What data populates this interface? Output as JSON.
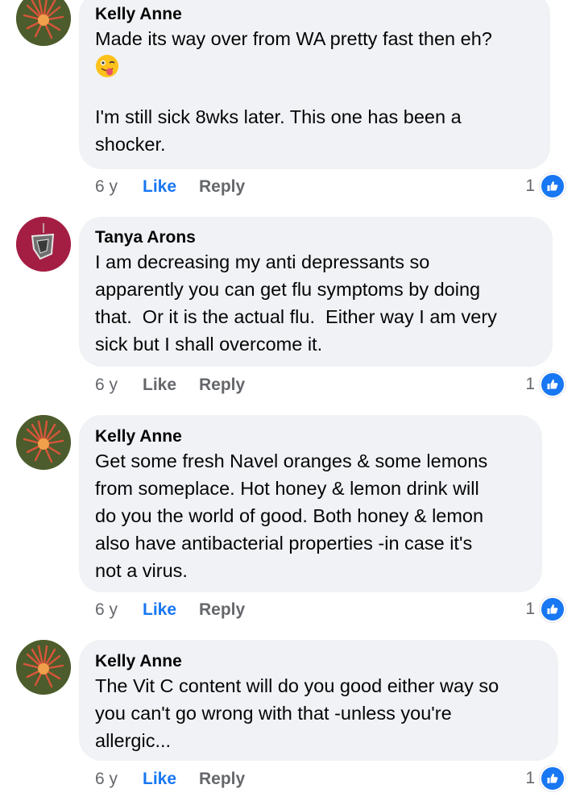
{
  "comments": [
    {
      "author": "Kelly Anne",
      "line1": "Made its way over from WA pretty fast then eh?",
      "line2": "I'm still sick 8wks later. This one has been a\nshocker.",
      "time": "6 y",
      "like": "Like",
      "reply": "Reply",
      "reactions": "1",
      "liked": true
    },
    {
      "author": "Tanya Arons",
      "text": "I am decreasing my anti depressants so\napparently you can get flu symptoms by doing\nthat.  Or it is the actual flu.  Either way I am very\nsick but I shall overcome it.",
      "time": "6 y",
      "like": "Like",
      "reply": "Reply",
      "reactions": "1",
      "liked": false
    },
    {
      "author": "Kelly Anne",
      "text": "Get some fresh Navel oranges & some lemons\nfrom someplace. Hot honey & lemon drink will\ndo you the world of good. Both honey & lemon\nalso have antibacterial properties -in case it's\nnot a virus.",
      "time": "6 y",
      "like": "Like",
      "reply": "Reply",
      "reactions": "1",
      "liked": true
    },
    {
      "author": "Kelly Anne",
      "text": "The Vit C content will do you good either way so\nyou can't go wrong with that -unless you're\nallergic...",
      "time": "6 y",
      "like": "Like",
      "reply": "Reply",
      "reactions": "1",
      "liked": true
    }
  ],
  "icons": {
    "emoji": "winking-tongue-face-icon",
    "reaction": "thumbs-up-icon"
  },
  "colors": {
    "accent": "#1877f2",
    "bubble": "#f0f2f5",
    "meta": "#65676b"
  }
}
